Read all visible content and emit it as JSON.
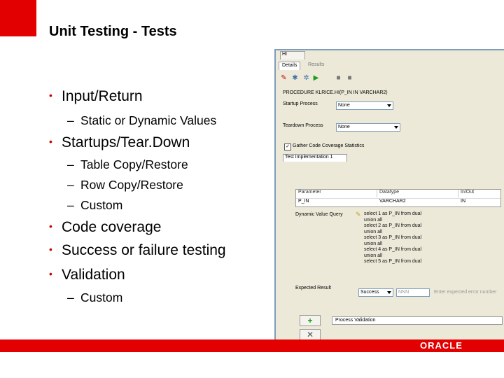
{
  "slide": {
    "title": "Unit Testing - Tests",
    "bullets": [
      {
        "text": "Input/Return",
        "subs": [
          "Static or Dynamic Values"
        ]
      },
      {
        "text": "Startups/Tear.Down",
        "subs": [
          "Table Copy/Restore",
          "Row Copy/Restore",
          "Custom"
        ]
      },
      {
        "text": "Code coverage",
        "subs": []
      },
      {
        "text": "Success or failure testing",
        "subs": []
      },
      {
        "text": "Validation",
        "subs": [
          "Custom"
        ]
      }
    ],
    "bullet_glyph": "•",
    "dash_glyph": "–",
    "accent_color": "#e30000"
  },
  "footer": {
    "logo_text": "ORACLE"
  },
  "screenshot": {
    "doc_tab": "HI",
    "tabs": {
      "details": "Details",
      "results": "Results"
    },
    "procedure": "PROCEDURE KLRICE.HI(P_IN IN VARCHAR2)",
    "startup_label": "Startup Process",
    "startup_value": "None",
    "teardown_label": "Teardown Process",
    "teardown_value": "None",
    "coverage_label": "Gather Code Coverage Statistics",
    "coverage_checked": true,
    "impl_tab": "Test Implementation 1",
    "table_headers": [
      "Parameter",
      "Datatype",
      "In/Out"
    ],
    "table_row": [
      "P_IN",
      "VARCHAR2",
      "IN"
    ],
    "dvq_label": "Dynamic Value Query",
    "sql_lines": [
      "select 1 as P_IN from dual",
      "union all",
      "select 2 as P_IN from dual",
      "union all",
      "select 3 as P_IN from dual",
      "union all",
      "select 4 as P_IN from dual",
      "union all",
      "select 5 as P_IN from dual"
    ],
    "expected_label": "Expected Result",
    "expected_value": "Success",
    "error_placeholder": "NNN",
    "error_hint": "Enter expected error number",
    "process_validation": "Process Validation",
    "icons": [
      "pin-icon",
      "settings-icon",
      "debug-icon",
      "run-icon",
      "disk-icon",
      "disk-icon"
    ]
  }
}
